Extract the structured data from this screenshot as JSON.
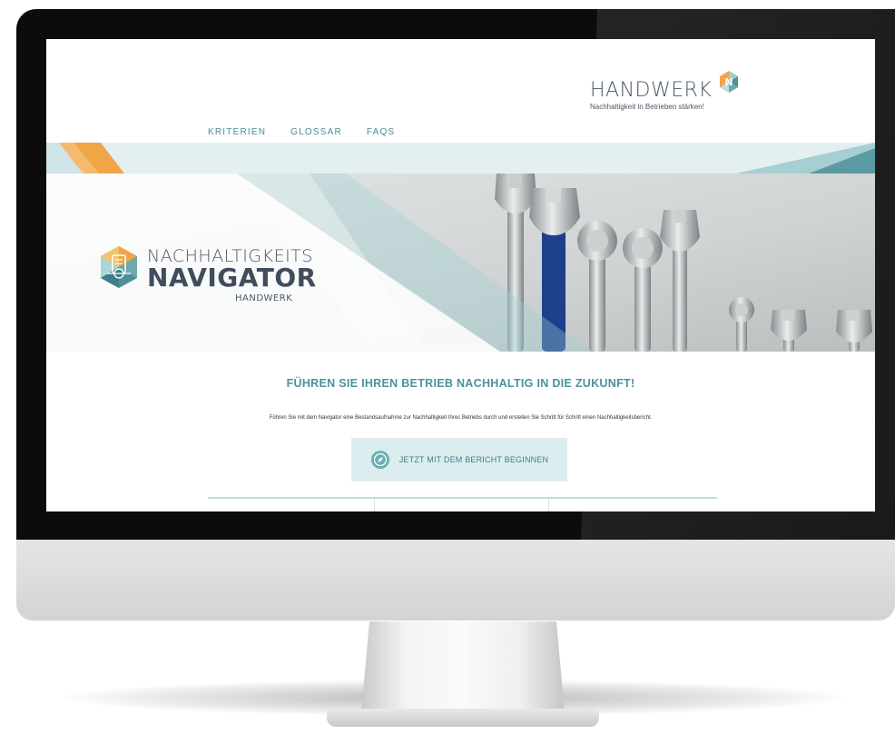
{
  "header": {
    "logo_word": "HANDWERK",
    "logo_tagline": "Nachhaltigkeit in Betrieben stärken!",
    "logo_badge_letter": "N"
  },
  "nav": {
    "items": [
      {
        "label": "KRITERIEN"
      },
      {
        "label": "GLOSSAR"
      },
      {
        "label": "FAQS"
      }
    ]
  },
  "hero": {
    "brand_line1": "NACHHALTIGKEITS",
    "brand_line2": "NAVIGATOR",
    "brand_line3": "HANDWERK"
  },
  "main": {
    "headline": "FÜHREN SIE IHREN BETRIEB NACHHALTIG IN DIE ZUKUNFT!",
    "intro": "Führen Sie mit dem Navigator eine Bestandsaufnahme zur Nachhaltigkeit Ihres Betriebs durch und erstellen Sie Schritt für Schritt einen Nachhaltigkeitsbericht.",
    "cta_label": "JETZT MIT DEM BERICHT BEGINNEN"
  },
  "colors": {
    "accent": "#4a929c",
    "nav_text": "#4d8c96",
    "cta_bg": "#dcedef",
    "dark_text": "#4a5866",
    "orange": "#f0a546"
  },
  "icons": [
    "handwerk-badge-icon",
    "navigator-logo-icon",
    "compass-icon"
  ]
}
